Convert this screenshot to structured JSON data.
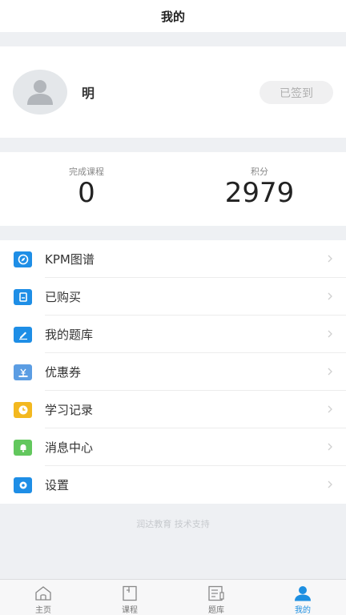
{
  "header": {
    "title": "我的"
  },
  "profile": {
    "name": "明",
    "checkin_label": "已签到"
  },
  "stats": [
    {
      "label": "完成课程",
      "value": "0"
    },
    {
      "label": "积分",
      "value": "2979"
    }
  ],
  "menu": [
    {
      "label": "KPM图谱",
      "icon": "compass-icon",
      "color": "#1e8ee6"
    },
    {
      "label": "已购买",
      "icon": "purchase-icon",
      "color": "#1e8ee6"
    },
    {
      "label": "我的题库",
      "icon": "pencil-icon",
      "color": "#1e8ee6"
    },
    {
      "label": "优惠券",
      "icon": "coupon-icon",
      "color": "#5b9de3"
    },
    {
      "label": "学习记录",
      "icon": "clock-icon",
      "color": "#f3b81f"
    },
    {
      "label": "消息中心",
      "icon": "bell-icon",
      "color": "#62c75d"
    },
    {
      "label": "设置",
      "icon": "gear-icon",
      "color": "#1e8ee6"
    }
  ],
  "footer_note": "润达教育 技术支持",
  "tabs": [
    {
      "label": "主页",
      "icon": "home-icon"
    },
    {
      "label": "课程",
      "icon": "book-icon"
    },
    {
      "label": "题库",
      "icon": "question-bank-icon"
    },
    {
      "label": "我的",
      "icon": "user-icon"
    }
  ],
  "colors": {
    "accent": "#1d8fe1",
    "background": "#eef0f3"
  }
}
